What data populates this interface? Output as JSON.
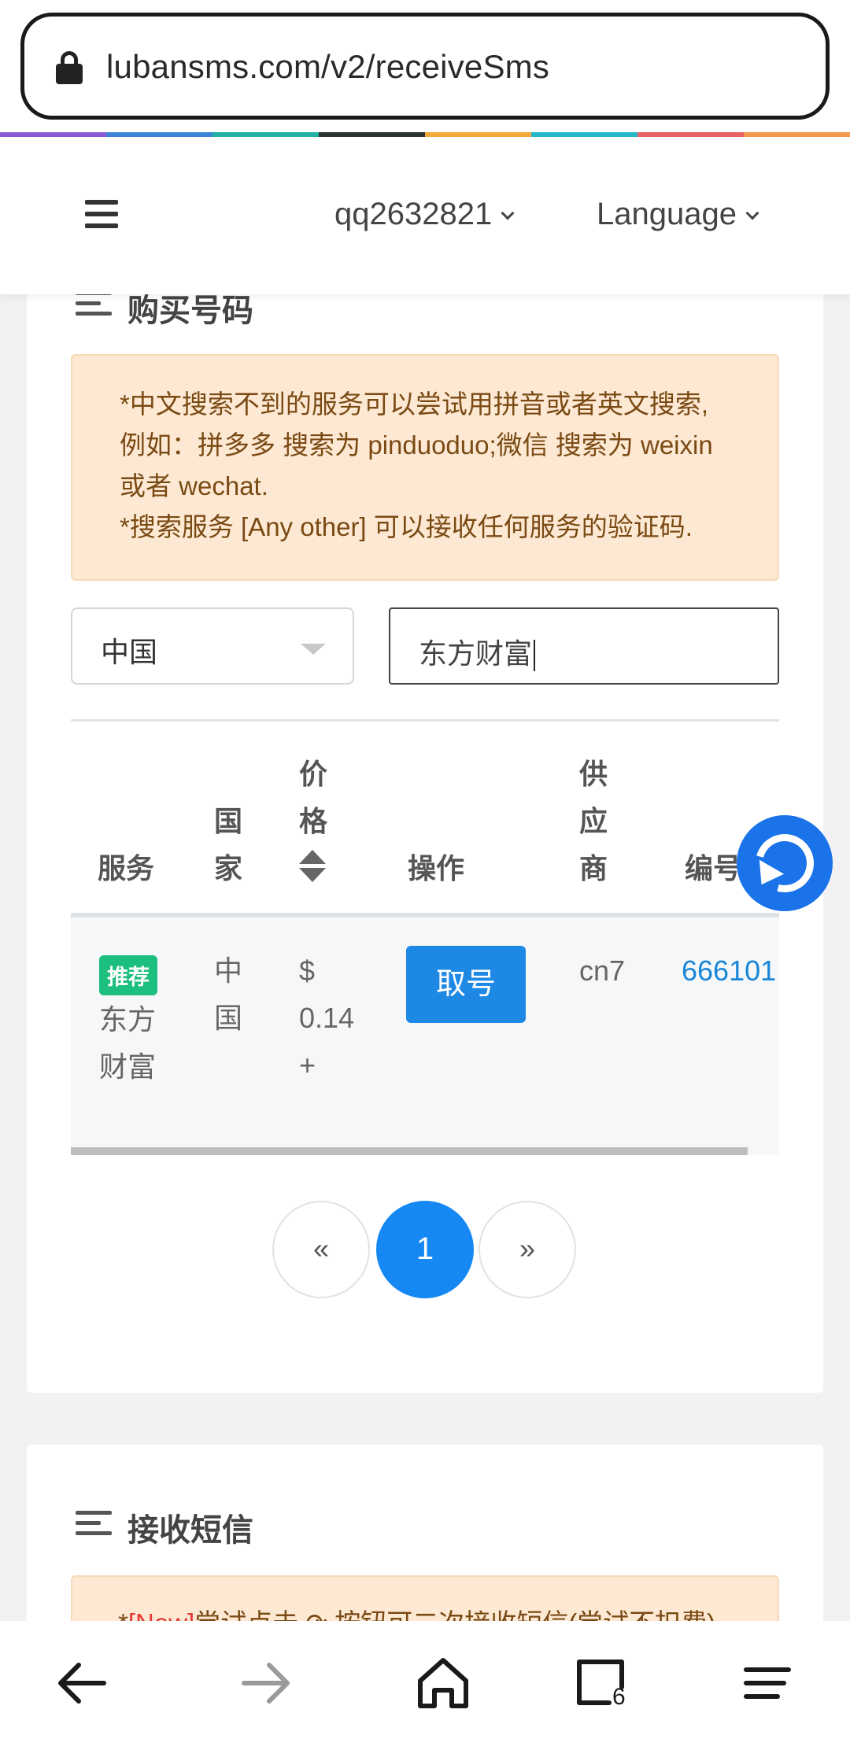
{
  "browser": {
    "url": "lubansms.com/v2/receiveSms",
    "tab_count": "6",
    "strip_colors": [
      "#8a5cd6",
      "#3e86d8",
      "#22b3a6",
      "#2d3436",
      "#f4a93b",
      "#27b8c9",
      "#e96464",
      "#f49b4d"
    ]
  },
  "nav": {
    "user": "qq2632821",
    "language": "Language"
  },
  "buy_section": {
    "title": "购买号码",
    "notice_line1": "*中文搜索不到的服务可以尝试用拼音或者英文搜索,例如：拼多多 搜索为 pinduoduo;微信 搜索为 weixin 或者 wechat.",
    "notice_line2": "*搜索服务 [Any other] 可以接收任何服务的验证码.",
    "country_select": "中国",
    "search_value": "东方财富"
  },
  "table": {
    "headers": {
      "service": "服务",
      "country": "国家",
      "price": "价格",
      "action": "操作",
      "provider": "供应商",
      "id": "编号"
    },
    "rows": [
      {
        "badge": "推荐",
        "service": "东方财富",
        "country": "中国",
        "price": "$ 0.14 +",
        "action_label": "取号",
        "provider": "cn7",
        "id": "666101"
      }
    ]
  },
  "pagination": {
    "prev": "«",
    "current": "1",
    "next": "»"
  },
  "receive_section": {
    "title": "接收短信",
    "notice_prefix": "*",
    "notice_new": "[New]",
    "notice_rest": "尝试点击 ⟳ 按钮可二次接收短信(尝试不扣费)"
  },
  "colors": {
    "primary_button": "#1e88e5",
    "pager_active": "#1688f3",
    "badge_green": "#1cbf7d",
    "link_blue": "#1a86d8",
    "alert_bg": "#fde9d3"
  }
}
